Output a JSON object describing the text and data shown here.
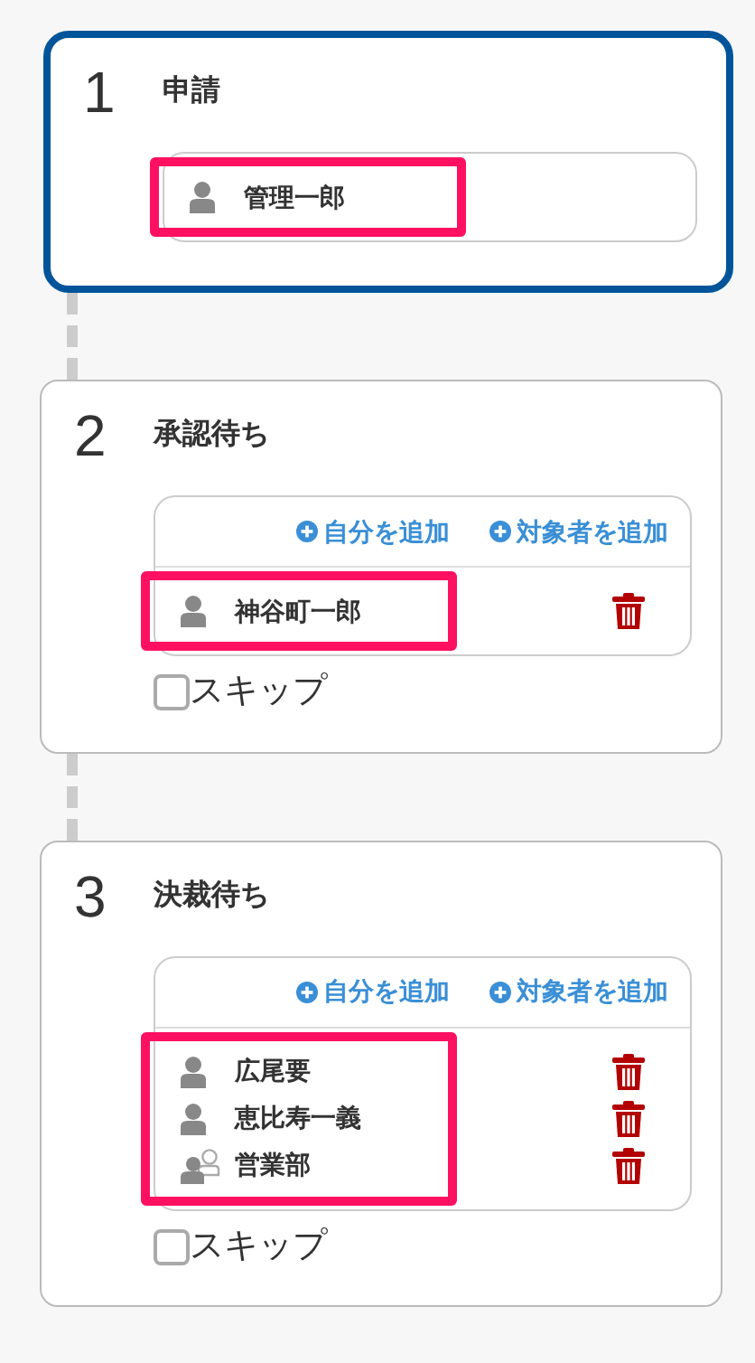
{
  "steps": [
    {
      "number": "1",
      "title": "申請",
      "active": true,
      "highlighted": true,
      "members": [
        {
          "kind": "person",
          "name": "管理一郎",
          "deletable": false
        }
      ]
    },
    {
      "number": "2",
      "title": "承認待ち",
      "active": false,
      "highlighted": true,
      "add_actions": [
        "自分を追加",
        "対象者を追加"
      ],
      "members": [
        {
          "kind": "person",
          "name": "神谷町一郎",
          "deletable": true
        }
      ],
      "skip": {
        "label": "スキップ",
        "checked": false
      }
    },
    {
      "number": "3",
      "title": "決裁待ち",
      "active": false,
      "highlighted": true,
      "add_actions": [
        "自分を追加",
        "対象者を追加"
      ],
      "members": [
        {
          "kind": "person",
          "name": "広尾要",
          "deletable": true
        },
        {
          "kind": "person",
          "name": "恵比寿一義",
          "deletable": true
        },
        {
          "kind": "group",
          "name": "営業部",
          "deletable": true
        }
      ],
      "skip": {
        "label": "スキップ",
        "checked": false
      }
    }
  ]
}
